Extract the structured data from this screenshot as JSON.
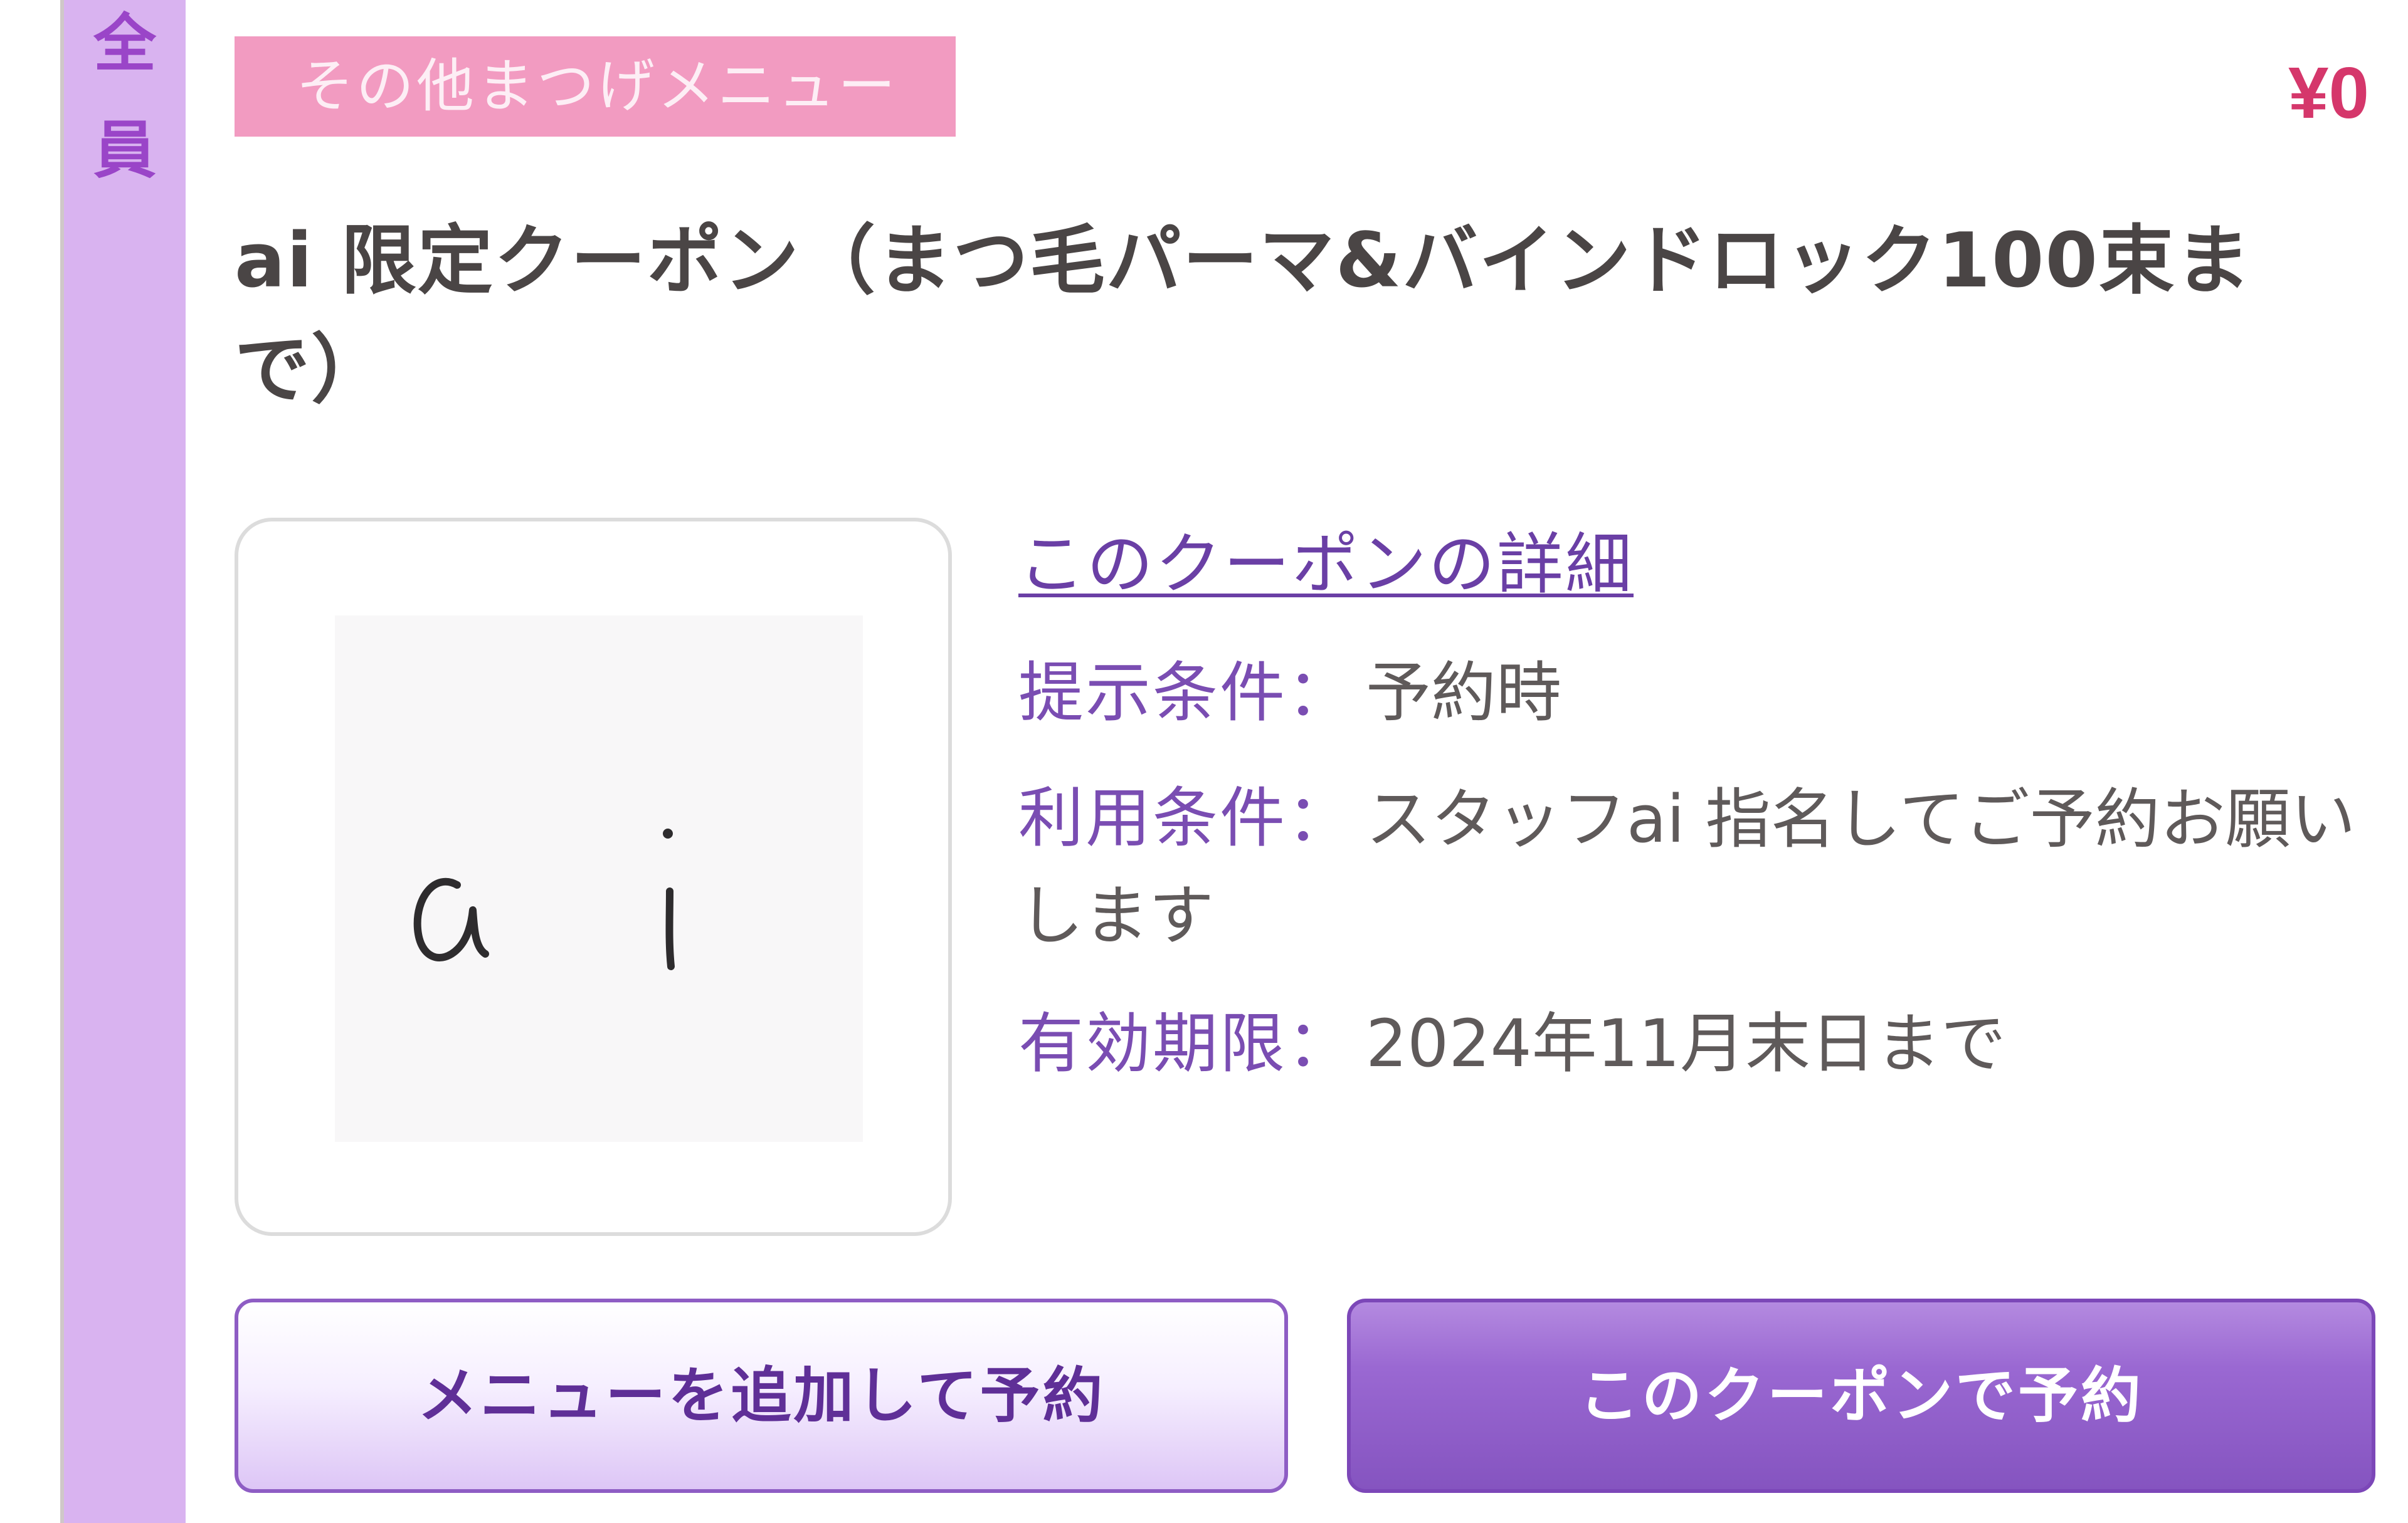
{
  "target": {
    "line1": "全",
    "line2": "員"
  },
  "coupon": {
    "category": "その他まつげメニュー",
    "price": "¥0",
    "title": "ai 限定クーポン（まつ毛パーマ&バインドロック100束まで）",
    "image_text": "ai",
    "detail_link": "このクーポンの詳細",
    "conditions": [
      {
        "label": "提示条件：",
        "value": "予約時"
      },
      {
        "label": "利用条件：",
        "value": "スタッフai 指名してご予約お願いします"
      },
      {
        "label": "有効期限：",
        "value": "2024年11月末日まで"
      }
    ]
  },
  "buttons": {
    "add_menu": "メニューを追加して予約",
    "book_coupon": "このクーポンで予約"
  },
  "colors": {
    "ribbon": "#d9b3f0",
    "ribbon_text": "#9a45c8",
    "badge": "#f29bc1",
    "price": "#d5376b",
    "label": "#7a4db2",
    "button_primary": "#8554c0"
  }
}
